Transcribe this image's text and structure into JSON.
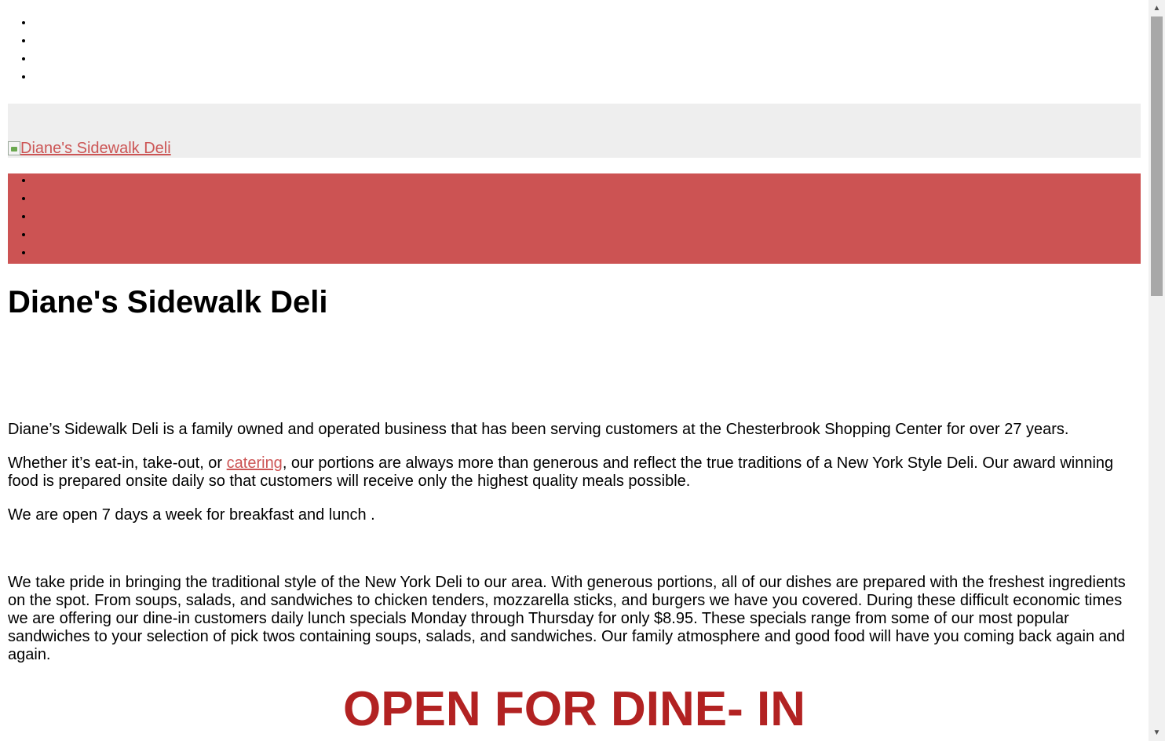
{
  "site": {
    "logo_alt": "Diane's Sidewalk Deli",
    "title": "Diane's Sidewalk Deli"
  },
  "top_nav": {
    "item_count": 4
  },
  "main_nav": {
    "item_count": 5
  },
  "content": {
    "p1": "Diane’s Sidewalk Deli is a family owned and operated business that has been serving customers at the Chesterbrook Shopping Center for over 27 years.",
    "p2_before": "Whether it’s eat-in, take-out, or ",
    "p2_link": "catering",
    "p2_after": ", our portions are always more than generous and reflect the true traditions of a New York Style Deli. Our award winning food is prepared onsite daily so that customers will receive only the highest quality meals possible.",
    "p3": "We are open 7 days a week for breakfast and lunch .",
    "p4": "We take pride in bringing the traditional style of the New York Deli to our area. With generous portions, all of our dishes are prepared with the freshest ingredients on the spot. From soups, salads, and sandwiches to chicken tenders, mozzarella sticks, and burgers we have you covered. During these difficult economic times we are offering our dine-in customers daily lunch specials Monday through Thursday for only $8.95. These specials range from some of our most popular sandwiches to your selection of pick twos containing soups, salads, and sandwiches. Our family atmosphere and good food will have you coming back again and again."
  },
  "banner": "OPEN FOR DINE- IN",
  "colors": {
    "nav_bar": "#cc5353",
    "logo_bar": "#eeeeee",
    "link": "#cc5555",
    "banner": "#b22222"
  },
  "icons": {
    "logo": "broken-image-icon",
    "scroll_up": "chevron-up-icon",
    "scroll_down": "chevron-down-icon"
  }
}
